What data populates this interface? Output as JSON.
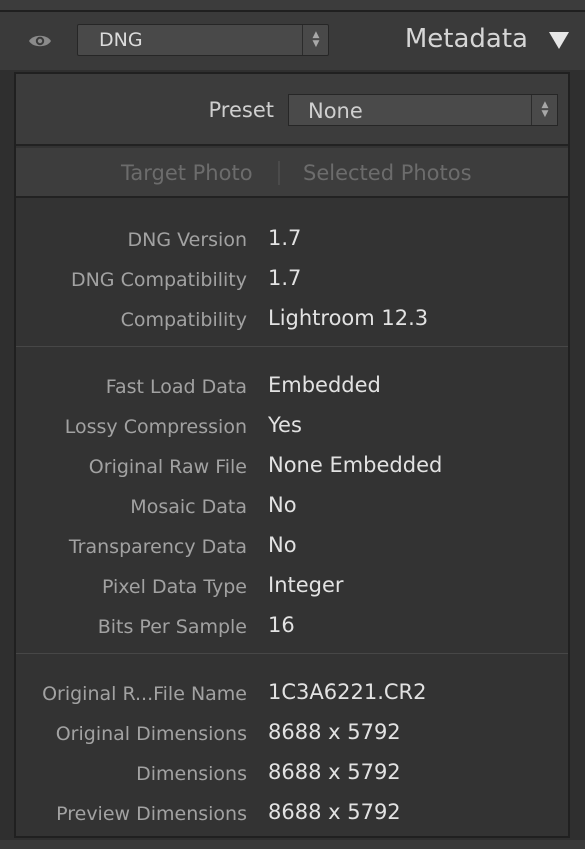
{
  "header": {
    "mode_value": "DNG",
    "panel_title": "Metadata"
  },
  "preset": {
    "label": "Preset",
    "value": "None"
  },
  "target_tabs": {
    "target": "Target Photo",
    "selected": "Selected Photos"
  },
  "groups": [
    {
      "rows": [
        {
          "label": "DNG Version",
          "value": "1.7"
        },
        {
          "label": "DNG Compatibility",
          "value": "1.7"
        },
        {
          "label": "Compatibility",
          "value": "Lightroom 12.3"
        }
      ]
    },
    {
      "rows": [
        {
          "label": "Fast Load Data",
          "value": "Embedded"
        },
        {
          "label": "Lossy Compression",
          "value": "Yes"
        },
        {
          "label": "Original Raw File",
          "value": "None Embedded"
        },
        {
          "label": "Mosaic Data",
          "value": "No"
        },
        {
          "label": "Transparency Data",
          "value": "No"
        },
        {
          "label": "Pixel Data Type",
          "value": "Integer"
        },
        {
          "label": "Bits Per Sample",
          "value": "16"
        }
      ]
    },
    {
      "rows": [
        {
          "label": "Original R...File Name",
          "value": "1C3A6221.CR2"
        },
        {
          "label": "Original Dimensions",
          "value": "8688 x 5792"
        },
        {
          "label": "Dimensions",
          "value": "8688 x 5792"
        },
        {
          "label": "Preview Dimensions",
          "value": "8688 x 5792"
        }
      ]
    }
  ],
  "icons": {
    "visibility": "eye-icon",
    "stepper": "up-down-arrows-icon",
    "collapse": "triangle-down-icon"
  }
}
